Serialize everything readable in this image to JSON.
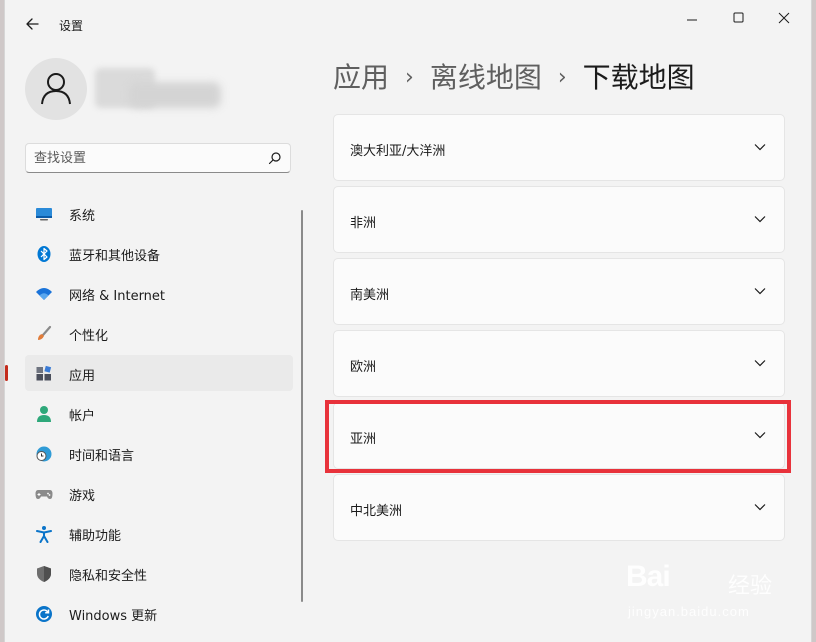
{
  "window": {
    "title": "设置",
    "minimize_icon": "minimize-icon",
    "maximize_icon": "maximize-icon",
    "close_icon": "close-icon"
  },
  "search": {
    "placeholder": "查找设置",
    "value": ""
  },
  "sidebar": {
    "items": [
      {
        "label": "系统",
        "icon": "system-icon",
        "color": "#0067c0"
      },
      {
        "label": "蓝牙和其他设备",
        "icon": "bluetooth-icon",
        "color": "#0078d4"
      },
      {
        "label": "网络 & Internet",
        "icon": "wifi-icon",
        "color": "#1a73d9"
      },
      {
        "label": "个性化",
        "icon": "brush-icon",
        "color": "#e07c3a"
      },
      {
        "label": "应用",
        "icon": "apps-icon",
        "color": "#3a7bd5",
        "selected": true
      },
      {
        "label": "帐户",
        "icon": "account-icon",
        "color": "#2ea87a"
      },
      {
        "label": "时间和语言",
        "icon": "clock-globe-icon",
        "color": "#2f9bd6"
      },
      {
        "label": "游戏",
        "icon": "gamepad-icon",
        "color": "#7a7a7a"
      },
      {
        "label": "辅助功能",
        "icon": "accessibility-icon",
        "color": "#0a74c9"
      },
      {
        "label": "隐私和安全性",
        "icon": "shield-icon",
        "color": "#6e6e6e"
      },
      {
        "label": "Windows 更新",
        "icon": "update-icon",
        "color": "#0a74c9"
      }
    ]
  },
  "breadcrumb": {
    "items": [
      "应用",
      "离线地图",
      "下载地图"
    ],
    "separator": "›"
  },
  "regions": [
    {
      "label": "澳大利亚/大洋洲"
    },
    {
      "label": "非洲"
    },
    {
      "label": "南美洲"
    },
    {
      "label": "欧洲"
    },
    {
      "label": "亚洲",
      "highlighted": true
    },
    {
      "label": "中北美洲"
    }
  ],
  "colors": {
    "accent": "#c42b1c",
    "highlight_box": "#e8323b"
  },
  "watermark": {
    "logo": "Bai",
    "brand": "经验",
    "url": "jingyan.baidu.com"
  }
}
